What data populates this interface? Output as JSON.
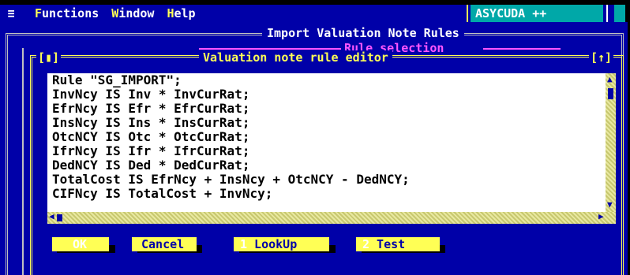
{
  "menubar": {
    "system_icon": "hamburger-icon",
    "items": [
      {
        "hot": "F",
        "rest": "unctions"
      },
      {
        "hot": "W",
        "rest": "indow"
      },
      {
        "hot": "H",
        "rest": "elp"
      }
    ],
    "brand": "ASYCUDA ++"
  },
  "window": {
    "title": "Import Valuation Note Rules",
    "subtitle": "Rule selection"
  },
  "editor": {
    "title": "Valuation note rule editor",
    "left_corner": "[▮]",
    "right_corner": "[↑]",
    "lines": [
      "Rule \"SG_IMPORT\";",
      "InvNcy IS Inv * InvCurRat;",
      "EfrNcy IS Efr * EfrCurRat;",
      "InsNcy IS Ins * InsCurRat;",
      "OtcNCY IS Otc * OtcCurRat;",
      "IfrNcy IS Ifr * IfrCurRat;",
      "DedNCY IS Ded * DedCurRat;",
      "TotalCost IS EfrNcy + InsNcy + OtcNCY - DedNCY;",
      "CIFNcy IS TotalCost + InvNcy;"
    ]
  },
  "buttons": {
    "ok": {
      "hot": "OK",
      "rest": ""
    },
    "cancel": {
      "hot": "",
      "rest": "Cancel"
    },
    "lookup": {
      "hot": "1",
      "rest": " LookUp"
    },
    "test": {
      "hot": "2",
      "rest": " Test"
    }
  },
  "colors": {
    "background": "#0000a8",
    "accent_yellow": "#ffff55",
    "accent_magenta": "#ff55ff",
    "brand_cyan": "#00a8a8"
  }
}
